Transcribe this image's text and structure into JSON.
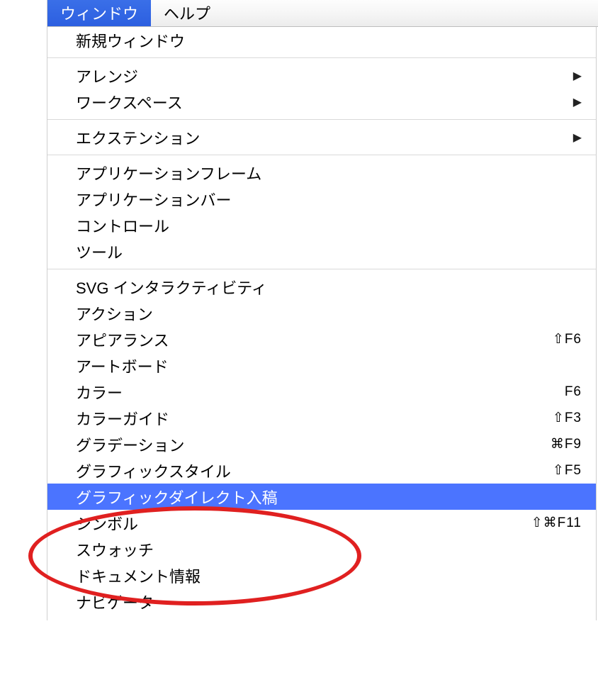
{
  "menubar": {
    "window": "ウィンドウ",
    "help": "ヘルプ"
  },
  "menu": {
    "new_window": "新規ウィンドウ",
    "arrange": "アレンジ",
    "workspace": "ワークスペース",
    "extension": "エクステンション",
    "app_frame": "アプリケーションフレーム",
    "app_bar": "アプリケーションバー",
    "control": "コントロール",
    "tool": "ツール",
    "svg_interactivity": "SVG インタラクティビティ",
    "action": "アクション",
    "appearance": "アピアランス",
    "appearance_sc": "⇧F6",
    "artboard": "アートボード",
    "color": "カラー",
    "color_sc": "F6",
    "color_guide": "カラーガイド",
    "color_guide_sc": "⇧F3",
    "gradation": "グラデーション",
    "gradation_sc": "⌘F9",
    "graphic_style": "グラフィックスタイル",
    "graphic_style_sc": "⇧F5",
    "graphic_direct": "グラフィックダイレクト入稿",
    "symbol": "シンボル",
    "symbol_sc": "⇧⌘F11",
    "swatch": "スウォッチ",
    "doc_info": "ドキュメント情報",
    "navigator": "ナビゲーター"
  }
}
